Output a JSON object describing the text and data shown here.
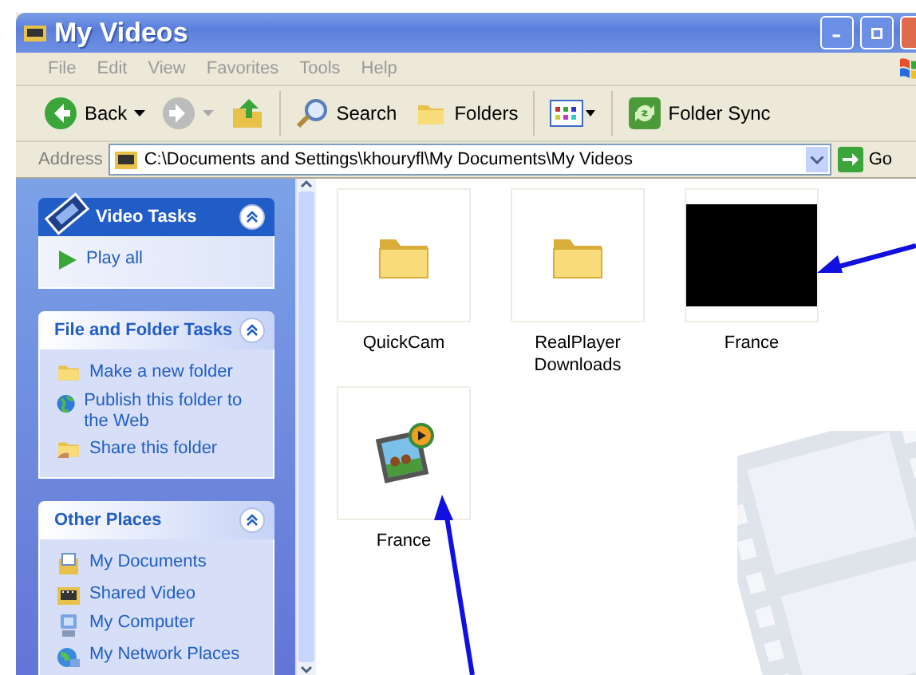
{
  "window": {
    "title": "My Videos"
  },
  "menu": [
    "File",
    "Edit",
    "View",
    "Favorites",
    "Tools",
    "Help"
  ],
  "toolbar": [
    {
      "kind": "back",
      "label": "Back"
    },
    {
      "kind": "forward"
    },
    {
      "kind": "up"
    },
    {
      "kind": "search",
      "label": "Search"
    },
    {
      "kind": "folders",
      "label": "Folders"
    },
    {
      "kind": "views"
    },
    {
      "kind": "sync",
      "label": "Folder Sync"
    }
  ],
  "address": {
    "label": "Address",
    "value": "C:\\Documents and Settings\\khouryfl\\My Documents\\My Videos",
    "go": "Go"
  },
  "task_panes": [
    {
      "kind": "special",
      "title": "Video Tasks",
      "expanded": true,
      "items": [
        {
          "kind": "play",
          "label": "Play all"
        }
      ]
    },
    {
      "kind": "normal",
      "title": "File and Folder Tasks",
      "expanded": true,
      "items": [
        {
          "kind": "newfolder",
          "label": "Make a new folder"
        },
        {
          "kind": "globe",
          "label": "Publish this folder to the Web"
        },
        {
          "kind": "share",
          "label": "Share this folder"
        }
      ]
    },
    {
      "kind": "normal",
      "title": "Other Places",
      "expanded": true,
      "items": [
        {
          "kind": "documents",
          "label": "My Documents"
        },
        {
          "kind": "video",
          "label": "Shared Video"
        },
        {
          "kind": "computer",
          "label": "My Computer"
        },
        {
          "kind": "network",
          "label": "My Network Places"
        }
      ]
    }
  ],
  "files": [
    {
      "kind": "folder",
      "name": "QuickCam"
    },
    {
      "kind": "folder",
      "name": "RealPlayer Downloads"
    },
    {
      "kind": "video",
      "name": "France"
    },
    {
      "kind": "media",
      "name": "France"
    }
  ]
}
